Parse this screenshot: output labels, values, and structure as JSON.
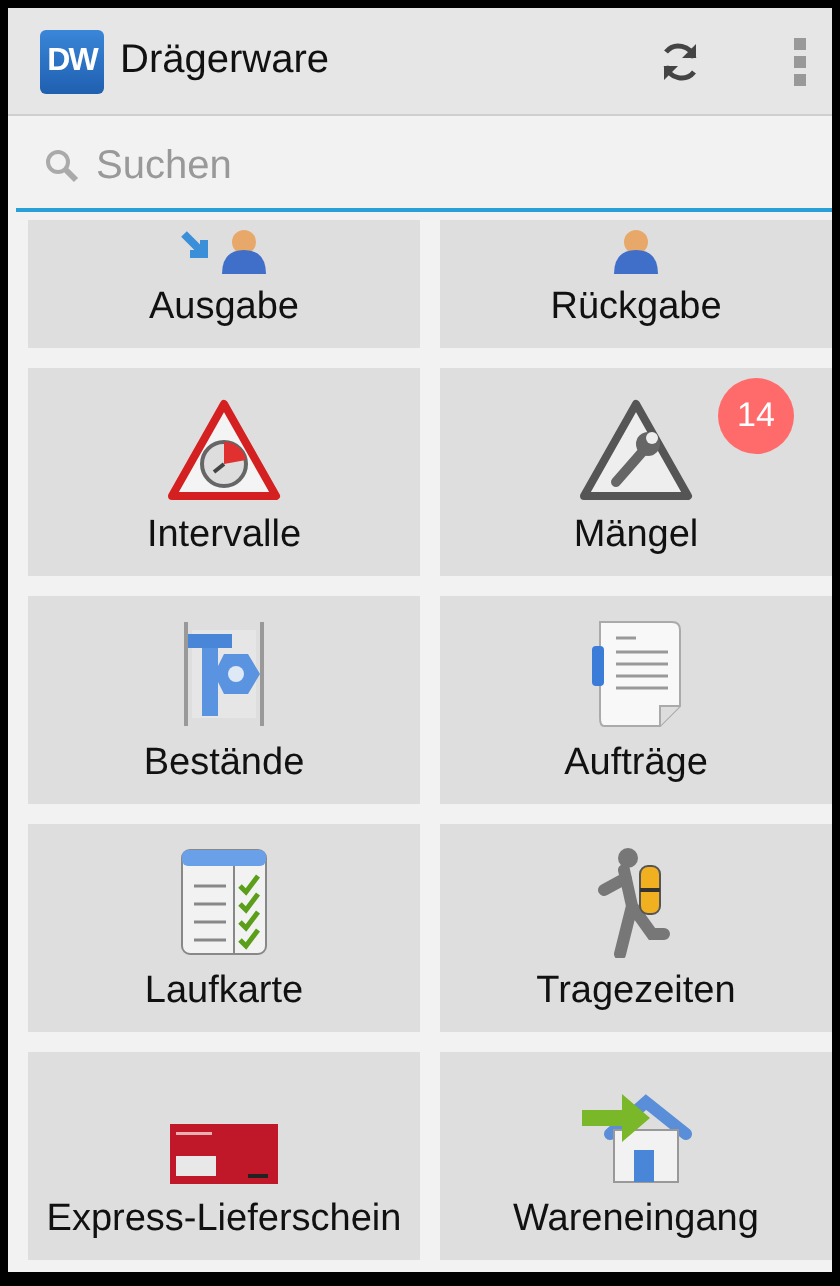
{
  "app_bar": {
    "logo": "DW",
    "title": "Drägerware"
  },
  "search": {
    "placeholder": "Suchen",
    "focused": true
  },
  "tiles": [
    {
      "label": "Ausgabe"
    },
    {
      "label": "Rückgabe"
    },
    {
      "label": "Intervalle"
    },
    {
      "label": "Mängel",
      "badge": "14"
    },
    {
      "label": "Bestände"
    },
    {
      "label": "Aufträge"
    },
    {
      "label": "Laufkarte"
    },
    {
      "label": "Tragezeiten"
    },
    {
      "label": "Express-Lieferschein"
    },
    {
      "label": "Wareneingang"
    }
  ]
}
